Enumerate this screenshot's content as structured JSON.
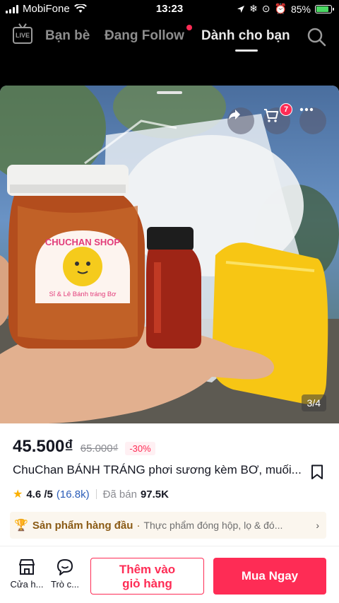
{
  "status_bar": {
    "carrier": "MobiFone",
    "time": "13:23",
    "battery": "85%",
    "battery_level": 0.85
  },
  "top_nav": {
    "live_label": "LIVE",
    "tabs": [
      {
        "label": "Bạn bè"
      },
      {
        "label": "Đang Follow"
      },
      {
        "label": "Dành cho bạn",
        "active": true
      }
    ]
  },
  "product": {
    "image_counter": "3/4",
    "cart_count": "7",
    "price": "45.500₫",
    "original_price": "65.000₫",
    "discount": "-30%",
    "title": "ChuChan BÁNH TRÁNG phơi sương kèm BƠ, muối...",
    "rating": "4.6 /5",
    "review_count": "(16.8k)",
    "sold_label": "Đã bán",
    "sold_count": "97.5K",
    "jar_label_top": "CHUCHAN SHOP",
    "jar_label_bottom": "Sỉ & Lẻ Bánh tráng Bơ"
  },
  "ranking": {
    "title": "Sản phẩm hàng đầu",
    "category": "Thực phẩm đóng hộp, lọ & đó..."
  },
  "bottom_bar": {
    "shop_label": "Cửa h...",
    "chat_label": "Trò c...",
    "add_to_cart_line1": "Thêm vào",
    "add_to_cart_line2": "giỏ hàng",
    "buy_now": "Mua Ngay"
  },
  "colors": {
    "accent": "#fe2c55",
    "rank_bg": "#fbf6ee",
    "link": "#2b5db8"
  },
  "icons": [
    "signal-icon",
    "wifi-icon",
    "location-icon",
    "alarm-icon",
    "battery-icon",
    "live-icon",
    "search-icon",
    "share-icon",
    "cart-icon",
    "more-icon",
    "bookmark-icon",
    "star-icon",
    "trophy-icon",
    "chevron-right-icon",
    "shop-icon",
    "chat-icon"
  ]
}
